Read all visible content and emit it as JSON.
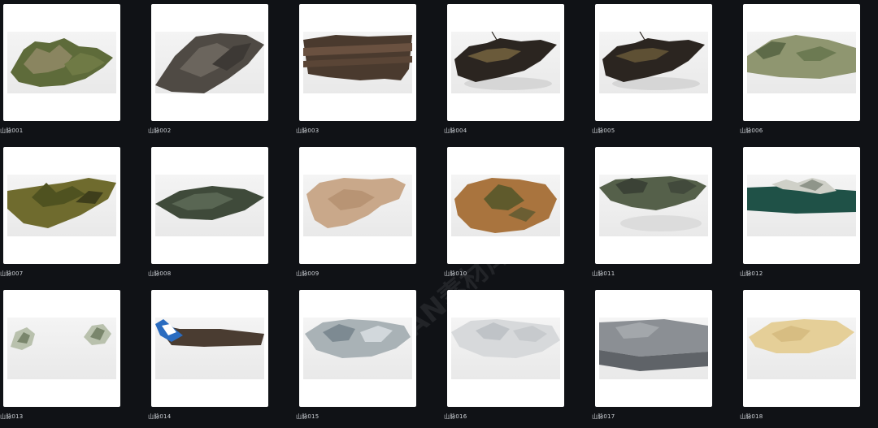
{
  "items": [
    {
      "label": "山脉001",
      "icon": "terrain-thumbnail-icon"
    },
    {
      "label": "山脉002",
      "icon": "terrain-thumbnail-icon"
    },
    {
      "label": "山脉003",
      "icon": "terrain-thumbnail-icon"
    },
    {
      "label": "山脉004",
      "icon": "terrain-thumbnail-icon"
    },
    {
      "label": "山脉005",
      "icon": "terrain-thumbnail-icon"
    },
    {
      "label": "山脉006",
      "icon": "terrain-thumbnail-icon"
    },
    {
      "label": "山脉007",
      "icon": "terrain-thumbnail-icon"
    },
    {
      "label": "山脉008",
      "icon": "terrain-thumbnail-icon"
    },
    {
      "label": "山脉009",
      "icon": "terrain-thumbnail-icon"
    },
    {
      "label": "山脉010",
      "icon": "terrain-thumbnail-icon"
    },
    {
      "label": "山脉011",
      "icon": "terrain-thumbnail-icon"
    },
    {
      "label": "山脉012",
      "icon": "terrain-thumbnail-icon"
    },
    {
      "label": "山脉013",
      "icon": "terrain-thumbnail-icon"
    },
    {
      "label": "山脉014",
      "icon": "terrain-thumbnail-icon"
    },
    {
      "label": "山脉015",
      "icon": "terrain-thumbnail-icon"
    },
    {
      "label": "山脉016",
      "icon": "terrain-thumbnail-icon"
    },
    {
      "label": "山脉017",
      "icon": "terrain-thumbnail-icon"
    },
    {
      "label": "山脉018",
      "icon": "terrain-thumbnail-icon"
    }
  ],
  "watermark": "AN素材库",
  "colors": {
    "background": "#101216",
    "card": "#ffffff",
    "label": "#cfd3d8"
  }
}
